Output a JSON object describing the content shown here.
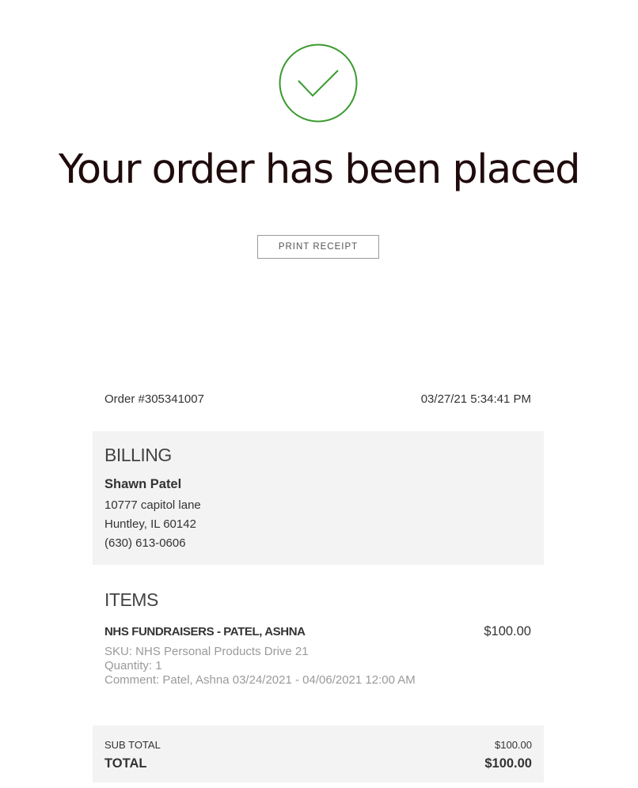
{
  "header": {
    "check_icon": "checkmark-circle-icon",
    "accent_color": "#3a9a2e",
    "headline": "Your order has been placed",
    "print_label": "PRINT RECEIPT"
  },
  "order": {
    "number": "Order #305341007",
    "datetime": "03/27/21 5:34:41 PM"
  },
  "billing": {
    "title": "BILLING",
    "name": "Shawn Patel",
    "address_line1": "10777 capitol lane",
    "address_line2": "Huntley, IL 60142",
    "phone": "(630) 613-0606"
  },
  "items": {
    "title": "ITEMS",
    "list": [
      {
        "name": "NHS FUNDRAISERS - PATEL, ASHNA",
        "price": "$100.00",
        "sku": "SKU: NHS Personal Products Drive 21",
        "quantity": "Quantity: 1",
        "comment": "Comment: Patel, Ashna 03/24/2021 - 04/06/2021 12:00 AM"
      }
    ]
  },
  "totals": {
    "subtotal_label": "SUB TOTAL",
    "subtotal_value": "$100.00",
    "total_label": "TOTAL",
    "total_value": "$100.00"
  }
}
